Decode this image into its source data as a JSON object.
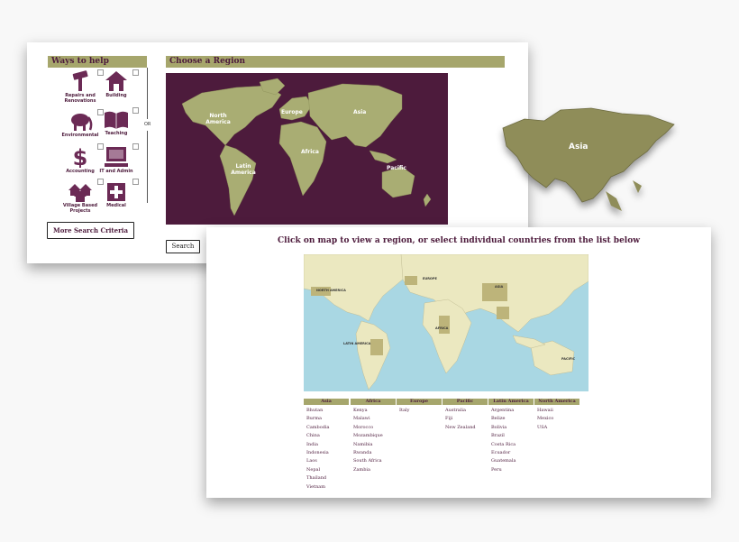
{
  "finder": {
    "ways_title": "Ways to help",
    "or_label": "OR",
    "help_items": [
      {
        "label": "Repairs and Renovations",
        "icon": "hammer-icon"
      },
      {
        "label": "Building",
        "icon": "house-icon"
      },
      {
        "label": "Environmental",
        "icon": "elephant-icon"
      },
      {
        "label": "Teaching",
        "icon": "book-icon"
      },
      {
        "label": "Accounting",
        "icon": "dollar-icon"
      },
      {
        "label": "IT and Admin",
        "icon": "computer-icon"
      },
      {
        "label": "Village Based Projects",
        "icon": "village-icon"
      },
      {
        "label": "Medical",
        "icon": "medical-cross-icon"
      }
    ],
    "more_button": "More Search Criteria",
    "region_title": "Choose a Region",
    "search_button": "Search",
    "map_labels": {
      "north_america": "North America",
      "europe": "Europe",
      "asia": "Asia",
      "africa": "Africa",
      "latin_america": "Latin America",
      "pacific": "Pacific"
    }
  },
  "asia_callout": {
    "label": "Asia"
  },
  "region_map": {
    "heading": "Click on map to view a region, or select individual countries from the list below",
    "map_labels": {
      "north_america": "NORTH AMERICA",
      "europe": "EUROPE",
      "asia": "ASIA",
      "africa": "AFRICA",
      "latin_america": "LATIN AMERICA",
      "pacific": "PACIFIC"
    },
    "columns": [
      {
        "title": "Asia",
        "countries": [
          "Bhutan",
          "Burma",
          "Cambodia",
          "China",
          "India",
          "Indonesia",
          "Laos",
          "Nepal",
          "Thailand",
          "Vietnam"
        ]
      },
      {
        "title": "Africa",
        "countries": [
          "Kenya",
          "Malawi",
          "Morocco",
          "Mozambique",
          "Namibia",
          "Rwanda",
          "South Africa",
          "Zambia"
        ]
      },
      {
        "title": "Europe",
        "countries": [
          "Italy"
        ]
      },
      {
        "title": "Pacific",
        "countries": [
          "Australia",
          "Fiji",
          "New Zealand"
        ]
      },
      {
        "title": "Latin America",
        "countries": [
          "Argentina",
          "Belize",
          "Bolivia",
          "Brazil",
          "Costa Rica",
          "Ecuador",
          "Guatemala",
          "Peru"
        ]
      },
      {
        "title": "North America",
        "countries": [
          "Hawaii",
          "Mexico",
          "USA"
        ]
      }
    ]
  },
  "colors": {
    "accent_bar": "#a6a66c",
    "brand_purple": "#4d1b3c",
    "land_olive": "#a9ad73",
    "ocean_blue": "#a9d7e3"
  }
}
